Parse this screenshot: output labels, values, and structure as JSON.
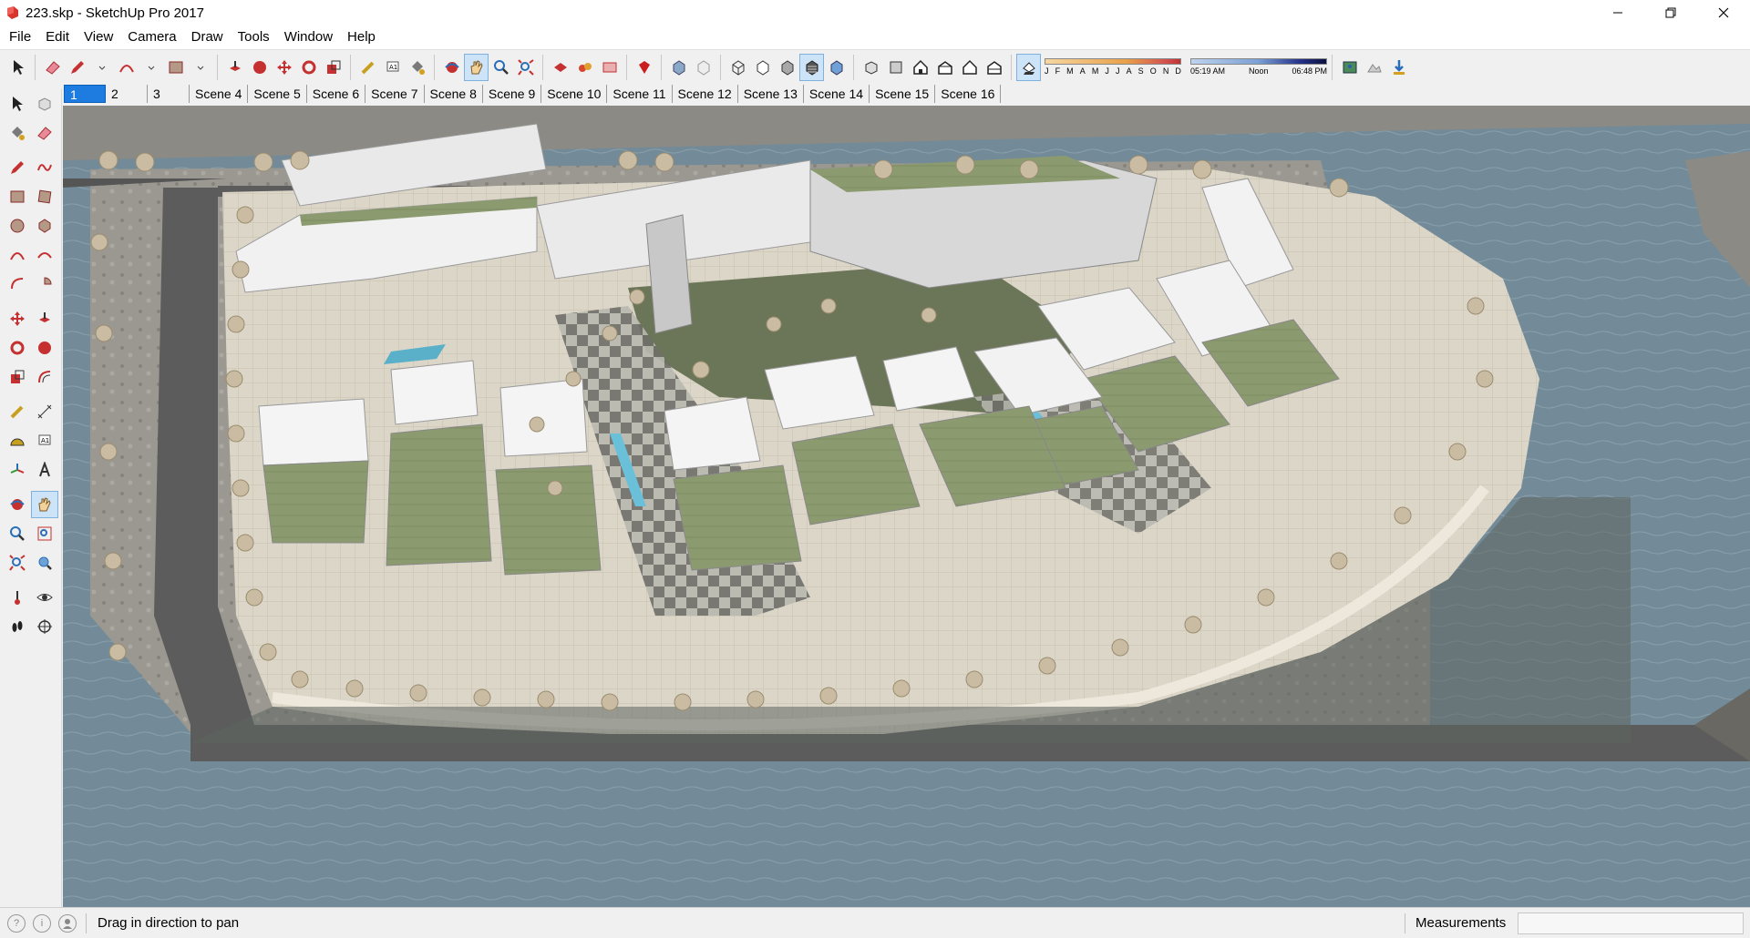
{
  "window": {
    "title": "223.skp - SketchUp Pro 2017",
    "minimize_icon": "minimize-icon",
    "maximize_icon": "restore-icon",
    "close_icon": "close-icon"
  },
  "menu": [
    "File",
    "Edit",
    "View",
    "Camera",
    "Draw",
    "Tools",
    "Window",
    "Help"
  ],
  "shadow_settings": {
    "months": [
      "J",
      "F",
      "M",
      "A",
      "M",
      "J",
      "J",
      "A",
      "S",
      "O",
      "N",
      "D"
    ],
    "time_start": "05:19 AM",
    "time_mid": "Noon",
    "time_end": "06:48 PM"
  },
  "scenes": [
    "1",
    "2",
    "3",
    "Scene 4",
    "Scene 5",
    "Scene 6",
    "Scene 7",
    "Scene 8",
    "Scene 9",
    "Scene 10",
    "Scene 11",
    "Scene 12",
    "Scene 13",
    "Scene 14",
    "Scene 15",
    "Scene 16"
  ],
  "active_scene": "1",
  "status": {
    "hint": "Drag in direction to pan",
    "measurements_label": "Measurements",
    "measurements_value": ""
  },
  "colors": {
    "water": "#6f8896",
    "ground": "#d8d2c4",
    "roof_green": "#8a9a6c",
    "building": "#f2f2f2",
    "road": "#5c5c5c"
  }
}
